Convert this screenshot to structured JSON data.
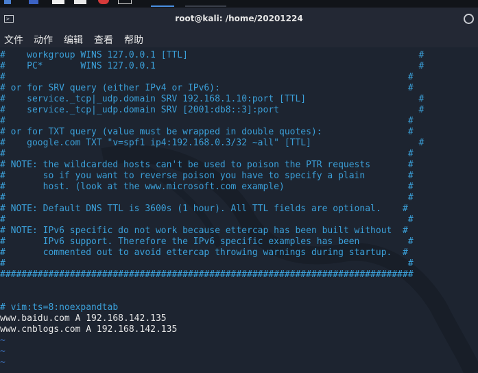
{
  "window": {
    "title": "root@kali: /home/20201224"
  },
  "menu": [
    "文件",
    "动作",
    "编辑",
    "查看",
    "帮助"
  ],
  "terminal": {
    "lines": [
      {
        "text": "#    workgroup WINS 127.0.0.1 [TTL]                                           #",
        "style": "comment"
      },
      {
        "text": "#    PC*       WINS 127.0.0.1                                                 #",
        "style": "comment"
      },
      {
        "text": "#                                                                           #",
        "style": "comment"
      },
      {
        "text": "# or for SRV query (either IPv4 or IPv6):                                   #",
        "style": "comment"
      },
      {
        "text": "#    service._tcp|_udp.domain SRV 192.168.1.10:port [TTL]                     #",
        "style": "comment"
      },
      {
        "text": "#    service._tcp|_udp.domain SRV [2001:db8::3]:port                          #",
        "style": "comment"
      },
      {
        "text": "#                                                                           #",
        "style": "comment"
      },
      {
        "text": "# or for TXT query (value must be wrapped in double quotes):                #",
        "style": "comment"
      },
      {
        "text": "#    google.com TXT \"v=spf1 ip4:192.168.0.3/32 ~all\" [TTL]                    #",
        "style": "comment"
      },
      {
        "text": "#                                                                           #",
        "style": "comment"
      },
      {
        "text": "# NOTE: the wildcarded hosts can't be used to poison the PTR requests       #",
        "style": "comment"
      },
      {
        "text": "#       so if you want to reverse poison you have to specify a plain        #",
        "style": "comment"
      },
      {
        "text": "#       host. (look at the www.microsoft.com example)                       #",
        "style": "comment"
      },
      {
        "text": "#                                                                           #",
        "style": "comment"
      },
      {
        "text": "# NOTE: Default DNS TTL is 3600s (1 hour). All TTL fields are optional.    #",
        "style": "comment"
      },
      {
        "text": "#                                                                           #",
        "style": "comment"
      },
      {
        "text": "# NOTE: IPv6 specific do not work because ettercap has been built without  #",
        "style": "comment"
      },
      {
        "text": "#       IPv6 support. Therefore the IPv6 specific examples has been         #",
        "style": "comment"
      },
      {
        "text": "#       commented out to avoid ettercap throwing warnings during startup.  #",
        "style": "comment"
      },
      {
        "text": "#                                                                           #",
        "style": "comment"
      },
      {
        "text": "#############################################################################",
        "style": "comment"
      },
      {
        "text": "",
        "style": "text"
      },
      {
        "text": "",
        "style": "text"
      },
      {
        "text": "# vim:ts=8:noexpandtab",
        "style": "comment"
      },
      {
        "text": "www.baidu.com A 192.168.142.135",
        "style": "text"
      },
      {
        "text": "www.cnblogs.com A 192.168.142.135",
        "style": "text"
      },
      {
        "text": "~",
        "style": "tilde"
      },
      {
        "text": "~",
        "style": "tilde"
      },
      {
        "text": "~",
        "style": "tilde"
      }
    ]
  },
  "colors": {
    "comment": "#3ba0d9",
    "text": "#e6e6e6",
    "tilde": "#3a6bb0",
    "background": "#1d2430"
  }
}
